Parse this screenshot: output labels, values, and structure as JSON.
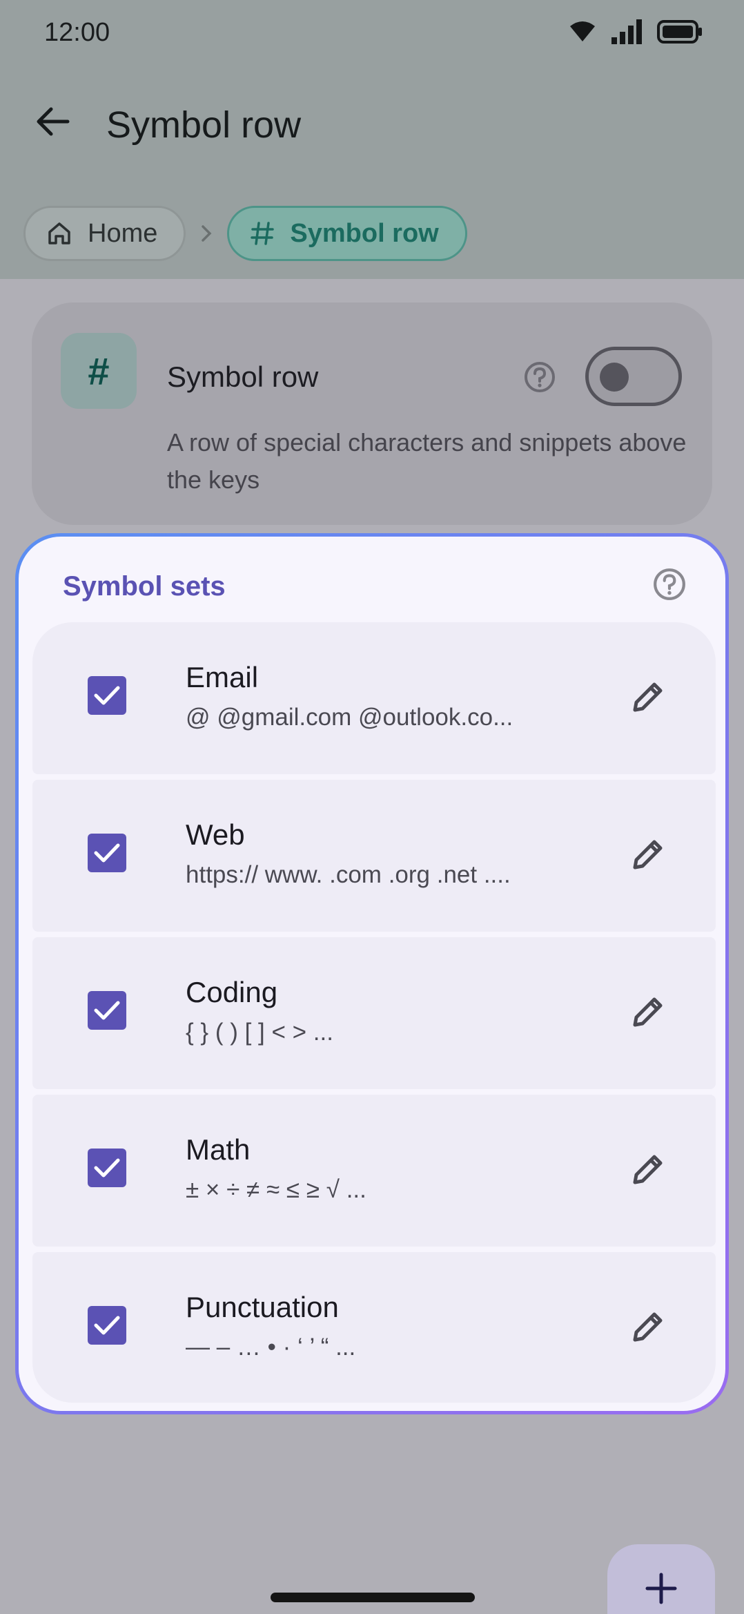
{
  "status_bar": {
    "time": "12:00"
  },
  "app_bar": {
    "title": "Symbol row"
  },
  "breadcrumb": {
    "home_label": "Home",
    "current_label": "Symbol row"
  },
  "feature_card": {
    "icon_glyph": "#",
    "title": "Symbol row",
    "description": "A row of special characters and snippets above the keys",
    "enabled": false
  },
  "symbol_sets": {
    "header": "Symbol sets",
    "items": [
      {
        "name": "Email",
        "preview": "@ @gmail.com @outlook.co...",
        "checked": true
      },
      {
        "name": "Web",
        "preview": "https:// www. .com .org .net ....",
        "checked": true
      },
      {
        "name": "Coding",
        "preview": "{ } ( ) [ ] < > ...",
        "checked": true
      },
      {
        "name": "Math",
        "preview": "± × ÷ ≠ ≈ ≤ ≥ √ ...",
        "checked": true
      },
      {
        "name": "Punctuation",
        "preview": "— – … • · ‘ ’ “ ...",
        "checked": true
      }
    ]
  },
  "colors": {
    "accent": "#5B52B4",
    "teal": "#1B6B5F",
    "scrim": "#B0AFB6",
    "card_gradient_start": "#5B8FF2",
    "card_gradient_end": "#9A6CF0"
  },
  "icons": {
    "back": "arrow-left-icon",
    "home": "home-icon",
    "separator": "chevron-right-icon",
    "hash": "hash-icon",
    "help": "help-circle-icon",
    "edit": "pencil-icon",
    "check": "check-icon",
    "fab": "plus-icon"
  }
}
